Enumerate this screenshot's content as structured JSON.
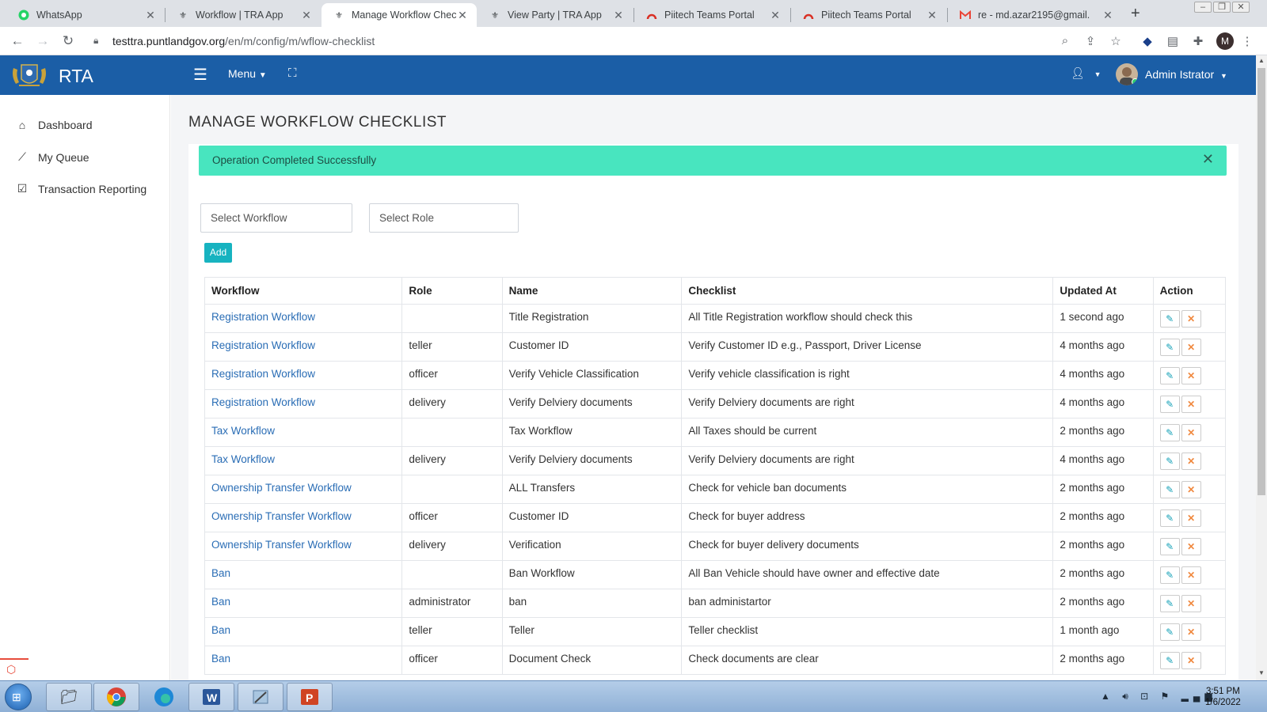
{
  "browser": {
    "tabs": [
      {
        "title": "WhatsApp",
        "icon": "whatsapp-icon"
      },
      {
        "title": "Workflow | TRA App",
        "icon": "rta-logo-icon"
      },
      {
        "title": "Manage Workflow Checkl",
        "icon": "rta-logo-icon",
        "active": true
      },
      {
        "title": "View Party | TRA App",
        "icon": "rta-logo-icon"
      },
      {
        "title": "Piitech Teams Portal",
        "icon": "piitech-icon"
      },
      {
        "title": "Piitech Teams Portal",
        "icon": "piitech-icon"
      },
      {
        "title": "re - md.azar2195@gmail.",
        "icon": "gmail-icon"
      }
    ],
    "url_host": "testtra.puntlandgov.org",
    "url_path": "/en/m/config/m/wflow-checklist",
    "profile_initial": "M"
  },
  "header": {
    "brand": "RTA",
    "menu_label": "Menu",
    "user_name": "Admin Istrator"
  },
  "sidebar": {
    "items": [
      {
        "label": "Dashboard",
        "icon": "home-icon"
      },
      {
        "label": "My Queue",
        "icon": "chart-line-icon"
      },
      {
        "label": "Transaction Reporting",
        "icon": "check-square-icon"
      }
    ]
  },
  "main": {
    "title": "MANAGE WORKFLOW CHECKLIST",
    "alert": "Operation Completed Successfully",
    "workflow_select": "Select Workflow",
    "role_select": "Select Role",
    "add_label": "Add",
    "columns": [
      "Workflow",
      "Role",
      "Name",
      "Checklist",
      "Updated At",
      "Action"
    ],
    "rows": [
      {
        "workflow": "Registration Workflow",
        "role": "",
        "name": "Title Registration",
        "checklist": "All Title Registration workflow should check this",
        "updated": "1 second ago"
      },
      {
        "workflow": "Registration Workflow",
        "role": "teller",
        "name": "Customer ID",
        "checklist": "Verify Customer ID e.g., Passport, Driver License",
        "updated": "4 months ago"
      },
      {
        "workflow": "Registration Workflow",
        "role": "officer",
        "name": "Verify Vehicle Classification",
        "checklist": "Verify vehicle classification is right",
        "updated": "4 months ago"
      },
      {
        "workflow": "Registration Workflow",
        "role": "delivery",
        "name": "Verify Delviery documents",
        "checklist": "Verify Delviery documents are right",
        "updated": "4 months ago"
      },
      {
        "workflow": "Tax Workflow",
        "role": "",
        "name": "Tax Workflow",
        "checklist": "All Taxes should be current",
        "updated": "2 months ago"
      },
      {
        "workflow": "Tax Workflow",
        "role": "delivery",
        "name": "Verify Delviery documents",
        "checklist": "Verify Delviery documents are right",
        "updated": "4 months ago"
      },
      {
        "workflow": "Ownership Transfer Workflow",
        "role": "",
        "name": "ALL Transfers",
        "checklist": "Check for vehicle ban documents",
        "updated": "2 months ago"
      },
      {
        "workflow": "Ownership Transfer Workflow",
        "role": "officer",
        "name": "Customer ID",
        "checklist": "Check for buyer address",
        "updated": "2 months ago"
      },
      {
        "workflow": "Ownership Transfer Workflow",
        "role": "delivery",
        "name": "Verification",
        "checklist": "Check for buyer delivery documents",
        "updated": "2 months ago"
      },
      {
        "workflow": "Ban",
        "role": "",
        "name": "Ban Workflow",
        "checklist": "All Ban Vehicle should have owner and effective date",
        "updated": "2 months ago"
      },
      {
        "workflow": "Ban",
        "role": "administrator",
        "name": "ban",
        "checklist": "ban administartor",
        "updated": "2 months ago"
      },
      {
        "workflow": "Ban",
        "role": "teller",
        "name": "Teller",
        "checklist": "Teller checklist",
        "updated": "1 month ago"
      },
      {
        "workflow": "Ban",
        "role": "officer",
        "name": "Document Check",
        "checklist": "Check documents are clear",
        "updated": "2 months ago"
      }
    ]
  },
  "taskbar": {
    "time": "3:51 PM",
    "date": "1/6/2022"
  },
  "colors": {
    "header_bg": "#1b5ea6",
    "alert_bg": "#48e5bf",
    "link": "#2a6db5",
    "add_button": "#17b3c0"
  }
}
